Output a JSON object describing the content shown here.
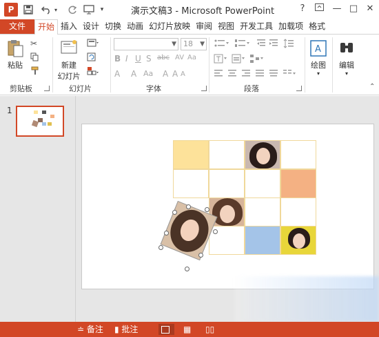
{
  "app": {
    "logo_letter": "P",
    "title": "演示文稿3 - Microsoft PowerPoint",
    "accent": "#d24726"
  },
  "quick_access": {
    "save_icon": "save-icon",
    "undo_icon": "undo-icon",
    "redo_icon": "redo-icon",
    "present_icon": "start-presentation-icon",
    "customize_icon": "customize-toolbar-icon"
  },
  "window_controls": {
    "help": "?",
    "restore_ribbon": "ribbon-display-icon",
    "minimize": "—",
    "maximize": "□",
    "close": "✕"
  },
  "tabs": [
    {
      "label": "文件"
    },
    {
      "label": "开始"
    },
    {
      "label": "插入"
    },
    {
      "label": "设计"
    },
    {
      "label": "切换"
    },
    {
      "label": "动画"
    },
    {
      "label": "幻灯片放映"
    },
    {
      "label": "审阅"
    },
    {
      "label": "视图"
    },
    {
      "label": "开发工具"
    },
    {
      "label": "加载项"
    },
    {
      "label": "格式"
    }
  ],
  "ribbon": {
    "clipboard": {
      "paste_label": "粘贴",
      "group_label": "剪贴板"
    },
    "slides": {
      "new_slide_label_1": "新建",
      "new_slide_label_2": "幻灯片",
      "group_label": "幻灯片"
    },
    "font": {
      "font_name_value": "",
      "font_size_value": "18",
      "group_label": "字体"
    },
    "paragraph": {
      "group_label": "段落"
    },
    "drawing": {
      "label": "绘图"
    },
    "editing": {
      "label": "编辑"
    }
  },
  "slide_panel": {
    "slide_number": "1"
  },
  "slide": {
    "grid_colors": {
      "yellow": "#fde29a",
      "orange": "#f4b183",
      "blue": "#a4c4e8",
      "border": "#f0d89a"
    }
  },
  "status_bar": {
    "notes_label": "备注",
    "comments_label": "批注"
  }
}
